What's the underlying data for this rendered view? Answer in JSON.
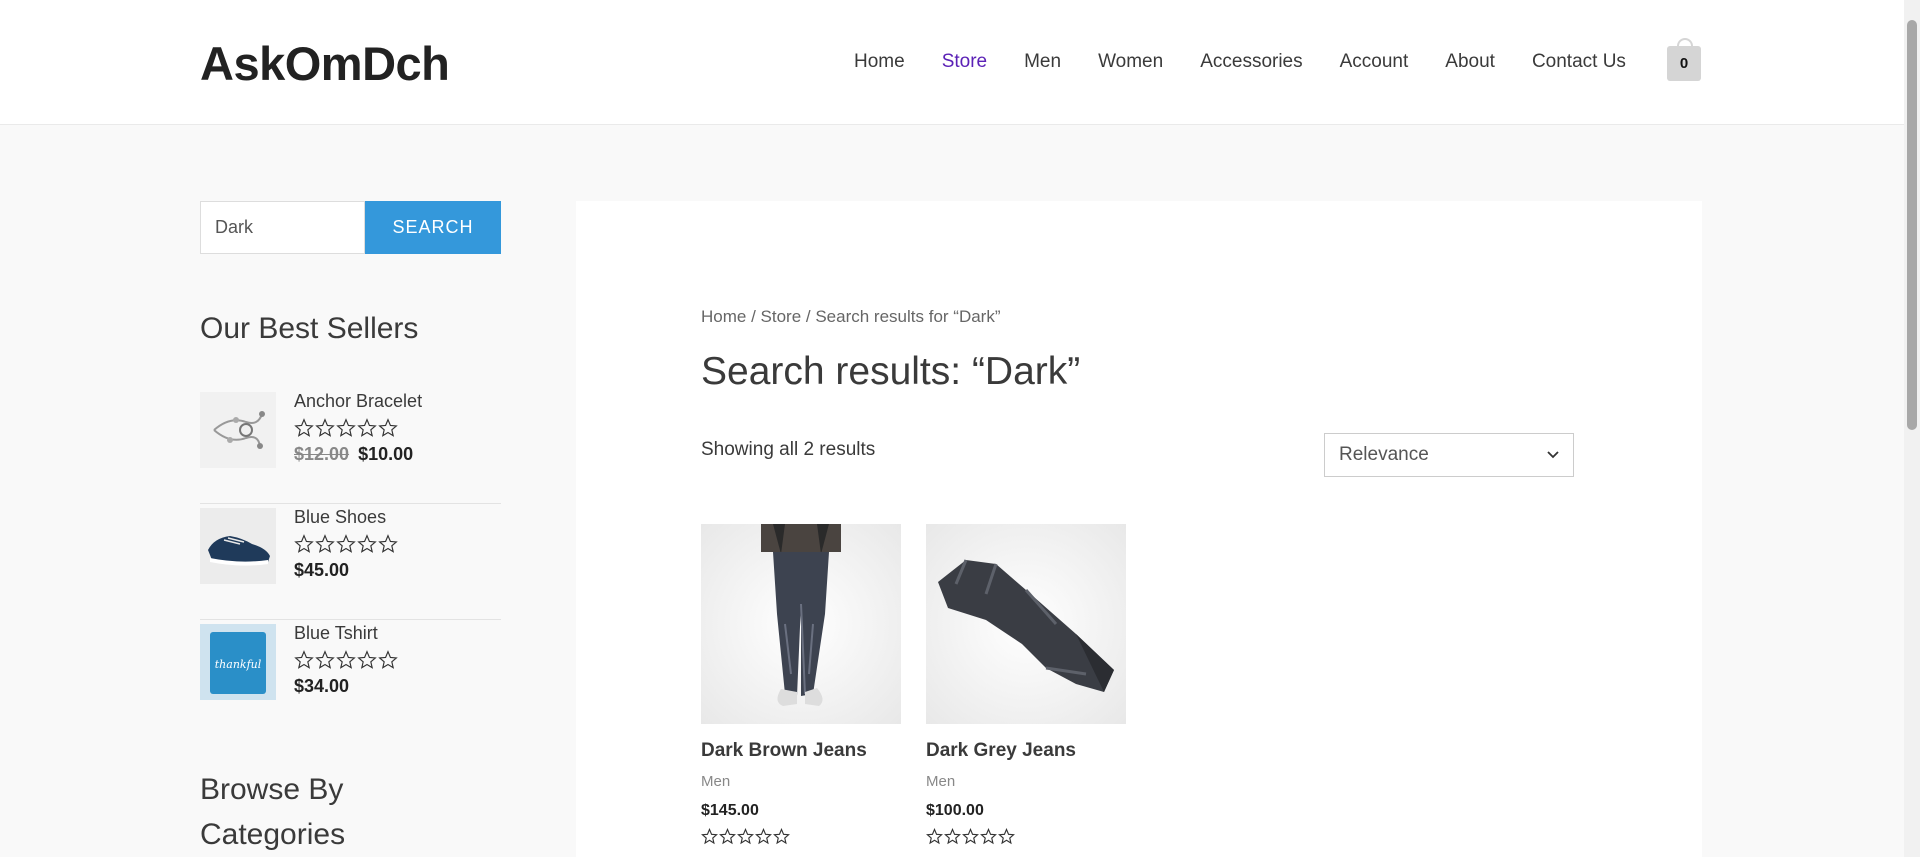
{
  "header": {
    "site_title": "AskOmDch",
    "nav": [
      "Home",
      "Store",
      "Men",
      "Women",
      "Accessories",
      "Account",
      "About",
      "Contact Us"
    ],
    "active_nav": "Store",
    "cart_count": "0"
  },
  "sidebar": {
    "search_value": "Dark",
    "search_button": "SEARCH",
    "best_sellers_title": "Our Best Sellers",
    "best_sellers": [
      {
        "name": "Anchor Bracelet",
        "old_price": "$12.00",
        "price": "$10.00",
        "rating": 0
      },
      {
        "name": "Blue Shoes",
        "old_price": "",
        "price": "$45.00",
        "rating": 0
      },
      {
        "name": "Blue Tshirt",
        "old_price": "",
        "price": "$34.00",
        "rating": 0
      }
    ],
    "categories_title_line1": "Browse By",
    "categories_title_line2": "Categories",
    "tshirt_text": "thankful"
  },
  "main": {
    "breadcrumb": {
      "home": "Home",
      "sep": " / ",
      "store": "Store",
      "current": "Search results for “Dark”"
    },
    "page_title": "Search results: “Dark”",
    "result_count": "Showing all 2 results",
    "ordering": "Relevance",
    "products": [
      {
        "title": "Dark Brown Jeans",
        "category": "Men",
        "price": "$145.00",
        "rating": 0
      },
      {
        "title": "Dark Grey Jeans",
        "category": "Men",
        "price": "$100.00",
        "rating": 0
      }
    ]
  },
  "colors": {
    "accent": "#3498db",
    "active_nav": "#5b21b6"
  }
}
